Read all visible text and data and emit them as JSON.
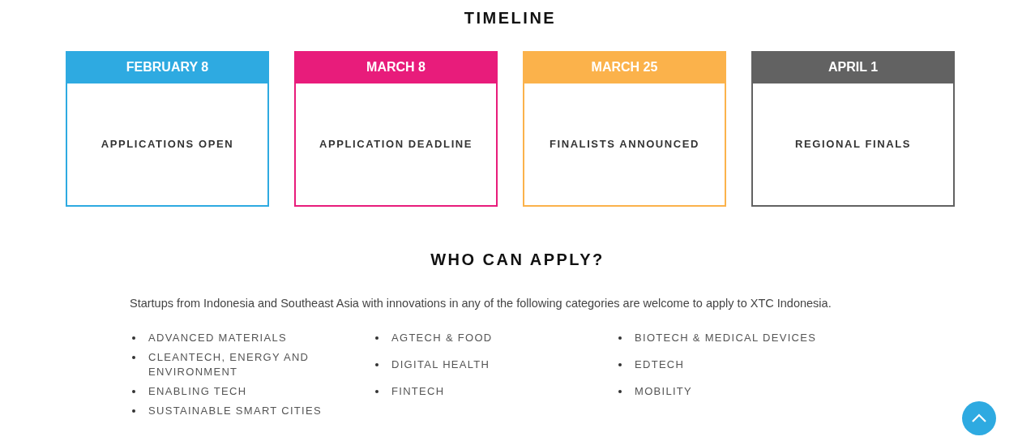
{
  "timeline": {
    "title": "TIMELINE",
    "milestones": [
      {
        "date": "FEBRUARY 8",
        "event": "APPLICATIONS OPEN",
        "color": "#2eaae1"
      },
      {
        "date": "MARCH 8",
        "event": "APPLICATION DEADLINE",
        "color": "#e81c7b"
      },
      {
        "date": "MARCH 25",
        "event": "FINALISTS ANNOUNCED",
        "color": "#fbb24b"
      },
      {
        "date": "APRIL 1",
        "event": "REGIONAL FINALS",
        "color": "#626262"
      }
    ]
  },
  "eligibility": {
    "title": "WHO CAN APPLY?",
    "intro": "Startups from Indonesia and Southeast Asia with innovations in any of the following categories are welcome to apply to XTC Indonesia.",
    "category_columns": [
      [
        "ADVANCED MATERIALS",
        "CLEANTECH, ENERGY AND ENVIRONMENT",
        "ENABLING TECH",
        "SUSTAINABLE SMART CITIES"
      ],
      [
        "AGTECH & FOOD",
        "DIGITAL HEALTH",
        "FINTECH"
      ],
      [
        "BIOTECH & MEDICAL DEVICES",
        "EDTECH",
        "MOBILITY"
      ]
    ]
  }
}
